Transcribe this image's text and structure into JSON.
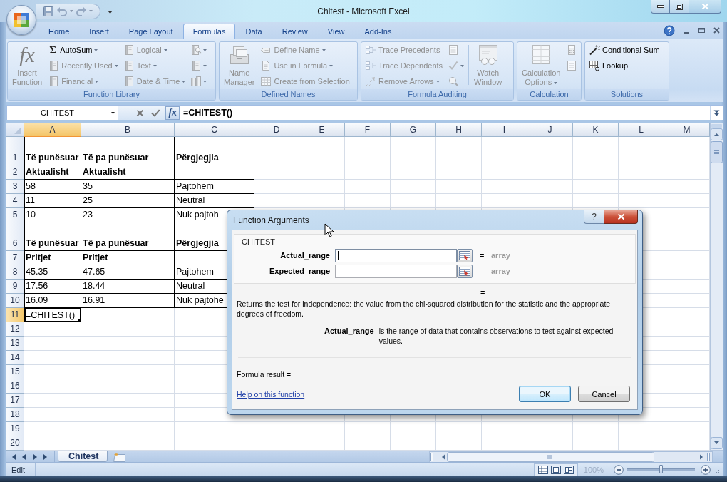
{
  "window": {
    "title": "Chitest - Microsoft Excel"
  },
  "ribbon": {
    "tabs": [
      {
        "label": "Home",
        "selected": false
      },
      {
        "label": "Insert",
        "selected": false
      },
      {
        "label": "Page Layout",
        "selected": false
      },
      {
        "label": "Formulas",
        "selected": true
      },
      {
        "label": "Data",
        "selected": false
      },
      {
        "label": "Review",
        "selected": false
      },
      {
        "label": "View",
        "selected": false
      },
      {
        "label": "Add-Ins",
        "selected": false
      }
    ],
    "groups": [
      {
        "label": "Function Library",
        "columns": [
          {
            "items": [
              {
                "kind": "large",
                "glyph": "fx",
                "label": "Insert Function",
                "menu": false,
                "disabled": true
              }
            ]
          },
          {
            "items": [
              {
                "kind": "small",
                "glyph": "Σ",
                "label": "AutoSum",
                "menu": true,
                "disabled": false
              },
              {
                "kind": "small",
                "label": "Recently Used",
                "menu": true,
                "disabled": true
              },
              {
                "kind": "small",
                "label": "Financial",
                "menu": true,
                "disabled": true
              }
            ]
          },
          {
            "items": [
              {
                "kind": "small",
                "label": "Logical",
                "menu": true,
                "disabled": true
              },
              {
                "kind": "small",
                "label": "Text",
                "menu": true,
                "disabled": true
              },
              {
                "kind": "small",
                "label": "Date & Time",
                "menu": true,
                "disabled": true
              }
            ]
          },
          {
            "items": [
              {
                "kind": "icon",
                "menu": true,
                "disabled": true
              },
              {
                "kind": "icon",
                "menu": true,
                "disabled": true
              },
              {
                "kind": "icon",
                "menu": true,
                "disabled": true
              }
            ]
          }
        ]
      },
      {
        "label": "Defined Names",
        "columns": [
          {
            "items": [
              {
                "kind": "large",
                "label": "Name Manager",
                "menu": false,
                "disabled": true
              }
            ]
          },
          {
            "items": [
              {
                "kind": "small",
                "label": "Define Name",
                "menu": true,
                "disabled": true
              },
              {
                "kind": "small",
                "label": "Use in Formula",
                "menu": true,
                "disabled": true
              },
              {
                "kind": "small",
                "label": "Create from Selection",
                "menu": false,
                "disabled": true
              }
            ]
          }
        ]
      },
      {
        "label": "Formula Auditing",
        "columns": [
          {
            "items": [
              {
                "kind": "small",
                "label": "Trace Precedents",
                "menu": false,
                "disabled": true
              },
              {
                "kind": "small",
                "label": "Trace Dependents",
                "menu": false,
                "disabled": true
              },
              {
                "kind": "small",
                "label": "Remove Arrows",
                "menu": true,
                "disabled": true
              }
            ]
          },
          {
            "items": [
              {
                "kind": "icon",
                "menu": false,
                "disabled": true
              },
              {
                "kind": "icon",
                "menu": true,
                "disabled": true
              },
              {
                "kind": "icon",
                "menu": false,
                "disabled": true
              }
            ]
          },
          {
            "items": [
              {
                "kind": "large",
                "label": "Watch Window",
                "menu": false,
                "disabled": true
              }
            ]
          }
        ]
      },
      {
        "label": "Calculation",
        "columns": [
          {
            "items": [
              {
                "kind": "large",
                "label": "Calculation Options",
                "menu": true,
                "disabled": true
              }
            ]
          },
          {
            "items": [
              {
                "kind": "icon",
                "menu": false,
                "disabled": true
              },
              {
                "kind": "icon",
                "menu": false,
                "disabled": true
              }
            ]
          }
        ]
      },
      {
        "label": "Solutions",
        "columns": [
          {
            "items": [
              {
                "kind": "small",
                "label": "Conditional Sum",
                "menu": false,
                "disabled": false
              },
              {
                "kind": "small",
                "label": "Lookup",
                "menu": false,
                "disabled": false
              }
            ]
          }
        ]
      }
    ]
  },
  "formula_bar": {
    "name_box": "CHITEST",
    "function_glyph": "fx",
    "formula": "=CHITEST()"
  },
  "sheet": {
    "columns": [
      {
        "label": "A",
        "selected": true
      },
      {
        "label": "B",
        "selected": false
      },
      {
        "label": "C",
        "selected": false
      },
      {
        "label": "D",
        "selected": false
      },
      {
        "label": "E",
        "selected": false
      },
      {
        "label": "F",
        "selected": false
      },
      {
        "label": "G",
        "selected": false
      },
      {
        "label": "H",
        "selected": false
      },
      {
        "label": "I",
        "selected": false
      },
      {
        "label": "J",
        "selected": false
      },
      {
        "label": "K",
        "selected": false
      },
      {
        "label": "L",
        "selected": false
      },
      {
        "label": "M",
        "selected": false
      }
    ],
    "rows": [
      {
        "label": "1",
        "kind": "title",
        "selected": false,
        "cells": [
          "Të punësuar",
          "Të pa punësuar",
          "Përgjegjia"
        ]
      },
      {
        "label": "2",
        "kind": "label",
        "selected": false,
        "cells": [
          "Aktualisht",
          "Aktualisht"
        ]
      },
      {
        "label": "3",
        "kind": "data",
        "selected": false,
        "cells": [
          "58",
          "35",
          "Pajtohem"
        ]
      },
      {
        "label": "4",
        "kind": "data",
        "selected": false,
        "cells": [
          "11",
          "25",
          "Neutral"
        ]
      },
      {
        "label": "5",
        "kind": "data",
        "selected": false,
        "cells": [
          "10",
          "23",
          "Nuk pajtoh"
        ]
      },
      {
        "label": "6",
        "kind": "title",
        "selected": false,
        "cells": [
          "Të punësuar",
          "Të pa punësuar",
          "Përgjegjia"
        ]
      },
      {
        "label": "7",
        "kind": "label",
        "selected": false,
        "cells": [
          "Pritjet",
          "Pritjet"
        ]
      },
      {
        "label": "8",
        "kind": "data",
        "selected": false,
        "cells": [
          "45.35",
          "47.65",
          "Pajtohem"
        ]
      },
      {
        "label": "9",
        "kind": "data",
        "selected": false,
        "cells": [
          "17.56",
          "18.44",
          "Neutral"
        ]
      },
      {
        "label": "10",
        "kind": "data",
        "selected": false,
        "cells": [
          "16.09",
          "16.91",
          "Nuk pajtohe"
        ]
      },
      {
        "label": "11",
        "kind": "plain",
        "selected": true,
        "cells": [
          "=CHITEST()"
        ]
      },
      {
        "label": "12",
        "kind": "plain",
        "selected": false
      },
      {
        "label": "13",
        "kind": "plain",
        "selected": false
      },
      {
        "label": "14",
        "kind": "plain",
        "selected": false
      },
      {
        "label": "15",
        "kind": "plain",
        "selected": false
      },
      {
        "label": "16",
        "kind": "plain",
        "selected": false
      },
      {
        "label": "17",
        "kind": "plain",
        "selected": false
      },
      {
        "label": "18",
        "kind": "plain",
        "selected": false
      },
      {
        "label": "19",
        "kind": "plain",
        "selected": false
      },
      {
        "label": "20",
        "kind": "plain",
        "selected": false
      }
    ]
  },
  "sheet_tabs": [
    {
      "label": "Chitest",
      "selected": true
    }
  ],
  "status_bar": {
    "mode": "Edit",
    "zoom": "100%",
    "zoom_slider": {
      "level": 0.5
    }
  },
  "dialog": {
    "title": "Function Arguments",
    "help_button": "?",
    "function": "CHITEST",
    "arguments": [
      {
        "label": "Actual_range",
        "focused": true,
        "sign": "=",
        "result": "array"
      },
      {
        "label": "Expected_range",
        "focused": false,
        "sign": "=",
        "result": "array"
      }
    ],
    "result_sign": "=",
    "description": "Returns the test for independence: the value from the chi-squared distribution for the statistic and the appropriate degrees of freedom.",
    "argument_help": {
      "name": "Actual_range",
      "text": "is the range of data that contains observations to test against expected values."
    },
    "formula_result": "Formula result =",
    "help_link": "Help on this function",
    "buttons": [
      {
        "label": "OK",
        "default": true
      },
      {
        "label": "Cancel",
        "default": false
      }
    ]
  }
}
